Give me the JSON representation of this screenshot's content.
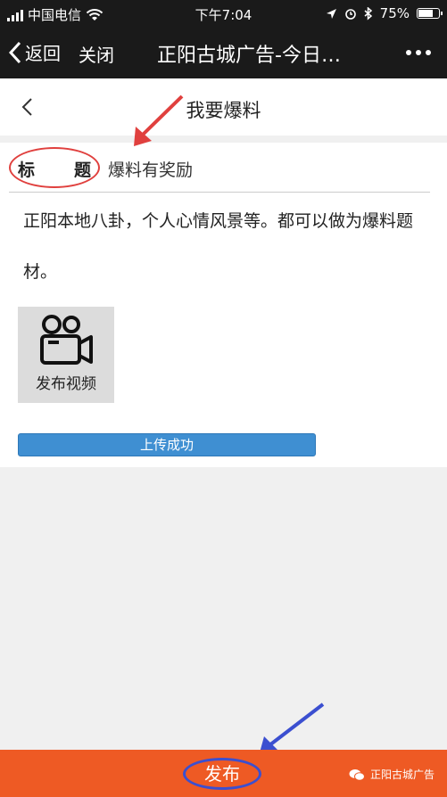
{
  "status_bar": {
    "carrier": "中国电信",
    "time": "下午7:04",
    "battery_percent": "75%",
    "battery_level": 0.75
  },
  "navbar": {
    "back_label": "返回",
    "close_label": "关闭",
    "title": "正阳古城广告-今日…"
  },
  "page_header": {
    "title": "我要爆料"
  },
  "form": {
    "title_label_1": "标",
    "title_label_2": "题",
    "title_value": "爆料有奖励",
    "body_text": "正阳本地八卦，个人心情风景等。都可以做为爆料题材。",
    "video_label": "发布视频",
    "upload_status": "上传成功"
  },
  "bottom_bar": {
    "publish_label": "发布",
    "watermark": "正阳古城广告"
  },
  "colors": {
    "status_bg": "#1a1a1a",
    "bottom_bar": "#ee5a24",
    "upload_bar": "#3f8fd2",
    "red_annotation": "#e0403e",
    "blue_annotation": "#3b4fd0"
  }
}
